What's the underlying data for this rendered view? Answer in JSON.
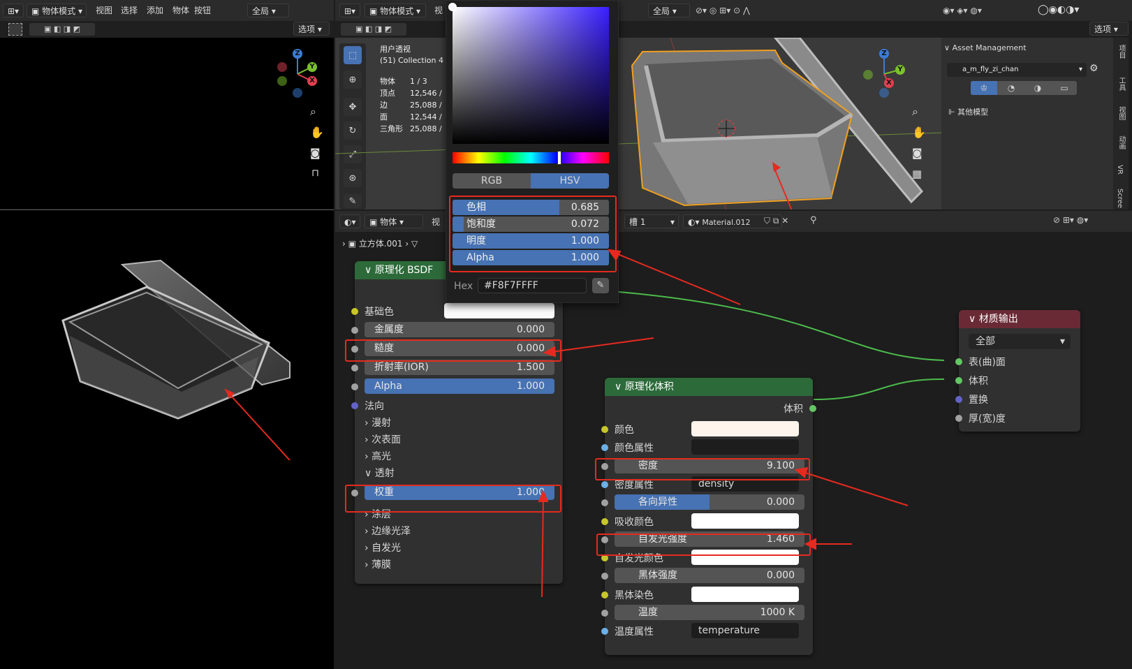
{
  "colors": {
    "accent": "#4772b3",
    "node_green": "#2d6a3a",
    "node_red": "#6a2a35",
    "annotation": "#e52a1f"
  },
  "left_header": {
    "mode": "物体模式",
    "menus": [
      "视图",
      "选择",
      "添加",
      "物体",
      "按钮"
    ],
    "transform": "全局",
    "options": "选项"
  },
  "mid_header": {
    "mode": "物体模式",
    "menu_cut": "视",
    "transform": "全局",
    "options": "选项"
  },
  "stats": {
    "view": "用户透视",
    "collection": "(51) Collection 4",
    "rows": [
      [
        "物体",
        "1 / 3"
      ],
      [
        "顶点",
        "12,546 /"
      ],
      [
        "边",
        "25,088 /"
      ],
      [
        "面",
        "12,544 /"
      ],
      [
        "三角形",
        "25,088 /"
      ]
    ]
  },
  "color_picker": {
    "tabs": [
      "RGB",
      "HSV"
    ],
    "active_tab": "HSV",
    "fields": [
      {
        "label": "色相",
        "value": "0.685",
        "fill": 0.685
      },
      {
        "label": "饱和度",
        "value": "0.072",
        "fill": 0.072
      },
      {
        "label": "明度",
        "value": "1.000",
        "fill": 1
      },
      {
        "label": "Alpha",
        "value": "1.000",
        "fill": 1
      }
    ],
    "hex_label": "Hex",
    "hex_value": "#F8F7FFFF"
  },
  "asset_panel": {
    "title": "Asset Management",
    "library": "a_m_fly_zi_chan",
    "item": "其他模型",
    "tabs": [
      "项目",
      "工具",
      "视图",
      "动画",
      "VR",
      "Scree"
    ]
  },
  "node_header": {
    "editor": "物体",
    "menu_cut": "视",
    "slot": "槽 1",
    "material": "Material.012",
    "breadcrumb": "立方体.001"
  },
  "bsdf": {
    "title": "原理化 BSDF",
    "base_color": "基础色",
    "metallic": {
      "label": "金属度",
      "value": "0.000"
    },
    "roughness": {
      "label": "糙度",
      "value": "0.000"
    },
    "ior": {
      "label": "折射率(IOR)",
      "value": "1.500"
    },
    "alpha": {
      "label": "Alpha",
      "value": "1.000"
    },
    "normal": "法向",
    "sections": [
      "漫射",
      "次表面",
      "高光",
      "透射"
    ],
    "weight": {
      "label": "权重",
      "value": "1.000"
    },
    "sections2": [
      "涂层",
      "边缘光泽",
      "自发光",
      "薄膜"
    ]
  },
  "volume": {
    "title": "原理化体积",
    "output": "体积",
    "rows": [
      {
        "label": "颜色",
        "kind": "swatch",
        "color": "#fff5ec"
      },
      {
        "label": "颜色属性",
        "kind": "dark"
      },
      {
        "label": "密度",
        "kind": "field",
        "value": "9.100"
      },
      {
        "label": "密度属性",
        "kind": "text",
        "value": "density"
      },
      {
        "label": "各向异性",
        "kind": "field",
        "value": "0.000"
      },
      {
        "label": "吸收颜色",
        "kind": "swatch",
        "color": "#ffffff"
      },
      {
        "label": "自发光强度",
        "kind": "field",
        "value": "1.460"
      },
      {
        "label": "自发光颜色",
        "kind": "swatch",
        "color": "#ffffff"
      },
      {
        "label": "黑体强度",
        "kind": "field",
        "value": "0.000"
      },
      {
        "label": "黑体染色",
        "kind": "swatch",
        "color": "#ffffff"
      },
      {
        "label": "温度",
        "kind": "field",
        "value": "1000 K"
      },
      {
        "label": "温度属性",
        "kind": "text",
        "value": "temperature"
      }
    ]
  },
  "output_node": {
    "title": "材质输出",
    "target": "全部",
    "inputs": [
      "表(曲)面",
      "体积",
      "置换",
      "厚(宽)度"
    ]
  }
}
